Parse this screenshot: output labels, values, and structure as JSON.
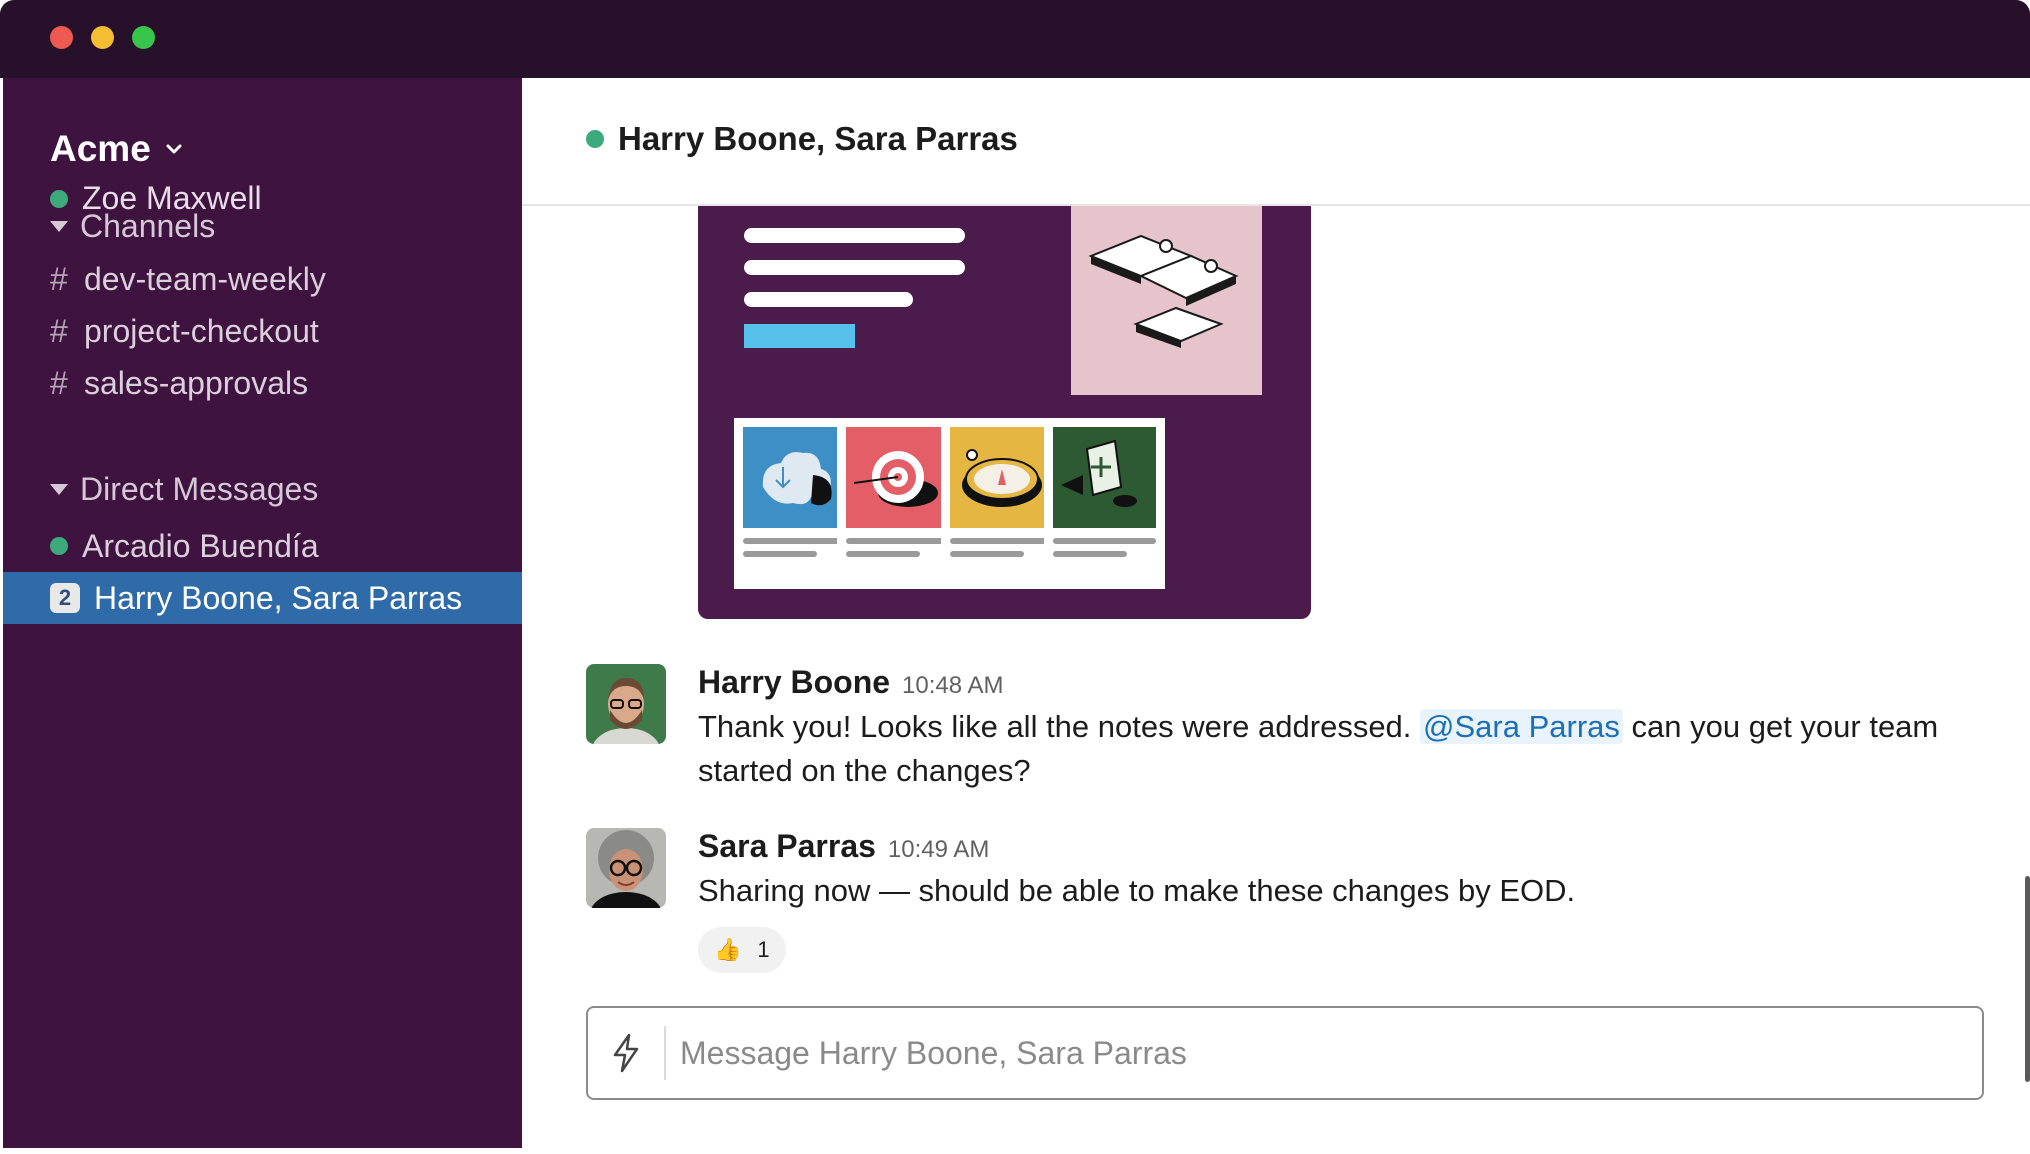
{
  "window": {
    "controls": [
      "close",
      "minimize",
      "zoom"
    ]
  },
  "sidebar": {
    "workspace": "Acme",
    "current_user": "Zoe Maxwell",
    "channels_header": "Channels",
    "channels": [
      {
        "prefix": "#",
        "name": "dev-team-weekly"
      },
      {
        "prefix": "#",
        "name": "project-checkout"
      },
      {
        "prefix": "#",
        "name": "sales-approvals"
      }
    ],
    "dm_header": "Direct Messages",
    "dms": [
      {
        "name": "Arcadio Buendía",
        "status": "online"
      },
      {
        "name": "Harry Boone, Sara Parras",
        "badge": "2",
        "active": true
      }
    ]
  },
  "conversation": {
    "title": "Harry Boone, Sara Parras",
    "messages": [
      {
        "sender": "Harry Boone",
        "time": "10:48 AM",
        "text_before": "Thank you! Looks like all the notes were addressed. ",
        "mention": "@Sara Parras",
        "text_after": " can you get your team started on the changes?"
      },
      {
        "sender": "Sara Parras",
        "time": "10:49 AM",
        "text": "Sharing now — should be able to make these changes by EOD.",
        "reaction": {
          "emoji": "👍",
          "count": "1"
        }
      }
    ],
    "composer_placeholder": "Message Harry Boone, Sara Parras"
  },
  "colors": {
    "titlebar": "#27102a",
    "sidebar": "#3e133f",
    "active_item": "#2f6ba8",
    "presence": "#3daa7c",
    "card": "#4a1b4b",
    "mention": "#1d6fb8"
  }
}
